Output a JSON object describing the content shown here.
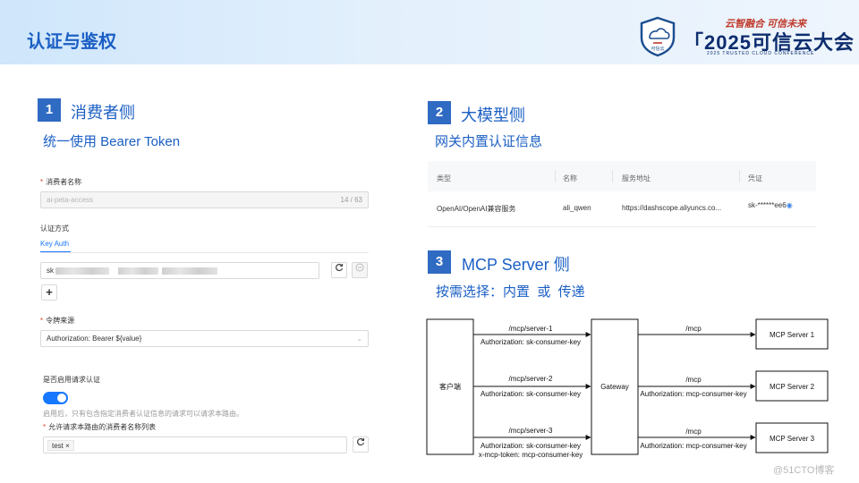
{
  "header": {
    "title": "认证与鉴权",
    "conference": {
      "slogan": "云智融合 可信未来",
      "name": "2025可信云大会",
      "subtitle": "2025 TRUSTED CLOUD CONFERENCE",
      "emblem_text": "可信云"
    }
  },
  "section1": {
    "number": "1",
    "title": "消费者侧",
    "subtitle": "统一使用 Bearer Token",
    "form": {
      "consumer_name_label": "消费者名称",
      "consumer_name_value": "ai-peta-access",
      "consumer_name_counter": "14 / 63",
      "auth_method_label": "认证方式",
      "auth_tab": "Key Auth",
      "key_prefix": "sk",
      "add_symbol": "+",
      "token_source_label": "令牌来源",
      "token_source_value": "Authorization: Bearer ${value}",
      "enable_auth_label": "是否启用请求认证",
      "enable_auth_on": true,
      "hint": "启用后，只有包含指定消费者认证信息的请求可以请求本路由。",
      "allowed_list_label": "允许请求本路由的消费者名称列表",
      "allowed_tag": "test"
    }
  },
  "section2": {
    "number": "2",
    "title": "大模型侧",
    "subtitle": "网关内置认证信息",
    "table": {
      "headers": [
        "类型",
        "名称",
        "服务地址",
        "凭证"
      ],
      "rows": [
        [
          "OpenAI/OpenAI兼容服务",
          "ali_qwen",
          "https://dashscope.aliyuncs.co...",
          "sk-******ee6"
        ]
      ]
    }
  },
  "section3": {
    "number": "3",
    "title": "MCP Server 侧",
    "subtitle": "按需选择：内置  或  传递",
    "diagram": {
      "client": "客户端",
      "gateway": "Gateway",
      "servers": [
        "MCP Server 1",
        "MCP Server 2",
        "MCP Server 3"
      ],
      "left_paths": [
        "/mcp/server-1",
        "/mcp/server-2",
        "/mcp/server-3"
      ],
      "left_auth": [
        "Authorization: sk-consumer-key",
        "Authorization: sk-consumer-key",
        "Authorization: sk-consumer-key"
      ],
      "extra_header": "x-mcp-token: mcp-consumer-key",
      "right_path": "/mcp",
      "right_auth": "Authorization: mcp-consumer-key"
    }
  },
  "watermark": "@51CTO博客",
  "colors": {
    "accent": "#1b5fc4",
    "badge": "#2f6ac3",
    "link": "#1677ff",
    "required": "#e0442c"
  }
}
